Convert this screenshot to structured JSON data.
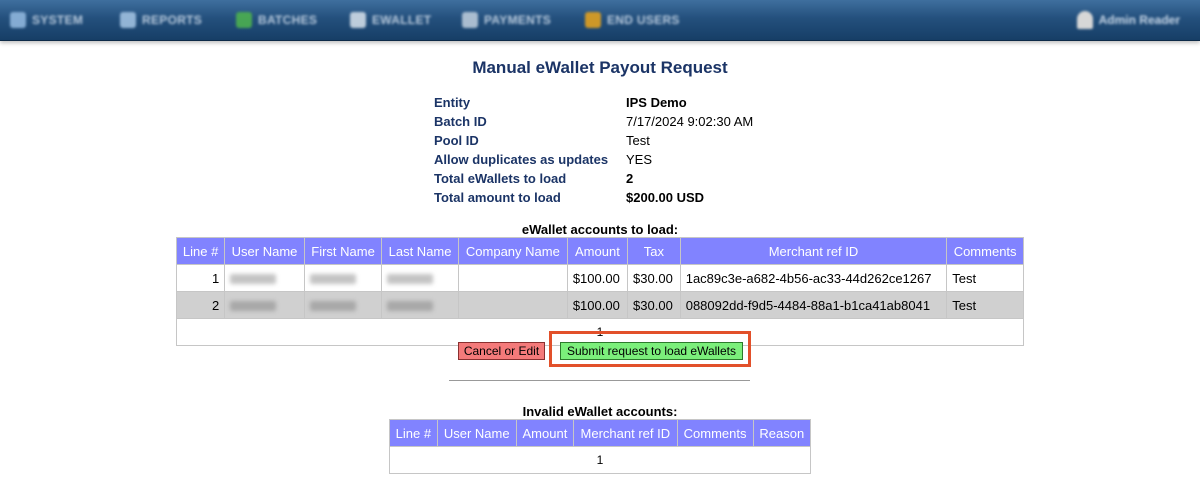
{
  "nav": {
    "items": [
      {
        "label": "SYSTEM",
        "icon": "system-icon",
        "color": "#8fb6dd"
      },
      {
        "label": "REPORTS",
        "icon": "reports-icon",
        "color": "#9fc0e0"
      },
      {
        "label": "BATCHES",
        "icon": "batches-icon",
        "color": "#4caf50"
      },
      {
        "label": "EWALLET",
        "icon": "ewallet-icon",
        "color": "#cfdbe6"
      },
      {
        "label": "PAYMENTS",
        "icon": "payments-icon",
        "color": "#b9c9d9"
      },
      {
        "label": "END USERS",
        "icon": "end-users-icon",
        "color": "#e0a020"
      }
    ],
    "user_label": "Admin Reader"
  },
  "page": {
    "title": "Manual eWallet Payout Request"
  },
  "summary": {
    "entity_label": "Entity",
    "entity_value": "IPS Demo",
    "batch_label": "Batch ID",
    "batch_value": "7/17/2024 9:02:30 AM",
    "pool_label": "Pool ID",
    "pool_value": "Test",
    "dup_label": "Allow duplicates as updates",
    "dup_value": "YES",
    "total_wallets_label": "Total eWallets to load",
    "total_wallets_value": "2",
    "total_amount_label": "Total amount to load",
    "total_amount_value": "$200.00 USD"
  },
  "accounts": {
    "caption": "eWallet accounts to load:",
    "headers": [
      "Line #",
      "User Name",
      "First Name",
      "Last Name",
      "Company Name",
      "Amount",
      "Tax",
      "Merchant ref ID",
      "Comments"
    ],
    "rows": [
      {
        "line": "1",
        "amount": "$100.00",
        "tax": "$30.00",
        "ref": "1ac89c3e-a682-4b56-ac33-44d262ce1267",
        "comments": "Test"
      },
      {
        "line": "2",
        "amount": "$100.00",
        "tax": "$30.00",
        "ref": "088092dd-f9d5-4484-88a1-b1ca41ab8041",
        "comments": "Test"
      }
    ],
    "pager": "1"
  },
  "actions": {
    "cancel_label": "Cancel or Edit",
    "submit_label": "Submit request to load eWallets"
  },
  "invalid": {
    "caption": "Invalid eWallet accounts:",
    "headers": [
      "Line #",
      "User Name",
      "Amount",
      "Merchant ref ID",
      "Comments",
      "Reason"
    ],
    "pager": "1"
  },
  "colors": {
    "header_bg": "#8183ff",
    "title": "#1b3466",
    "cancel_bg": "#f47a7a",
    "submit_bg": "#7bef7b",
    "highlight": "#e2502a"
  }
}
